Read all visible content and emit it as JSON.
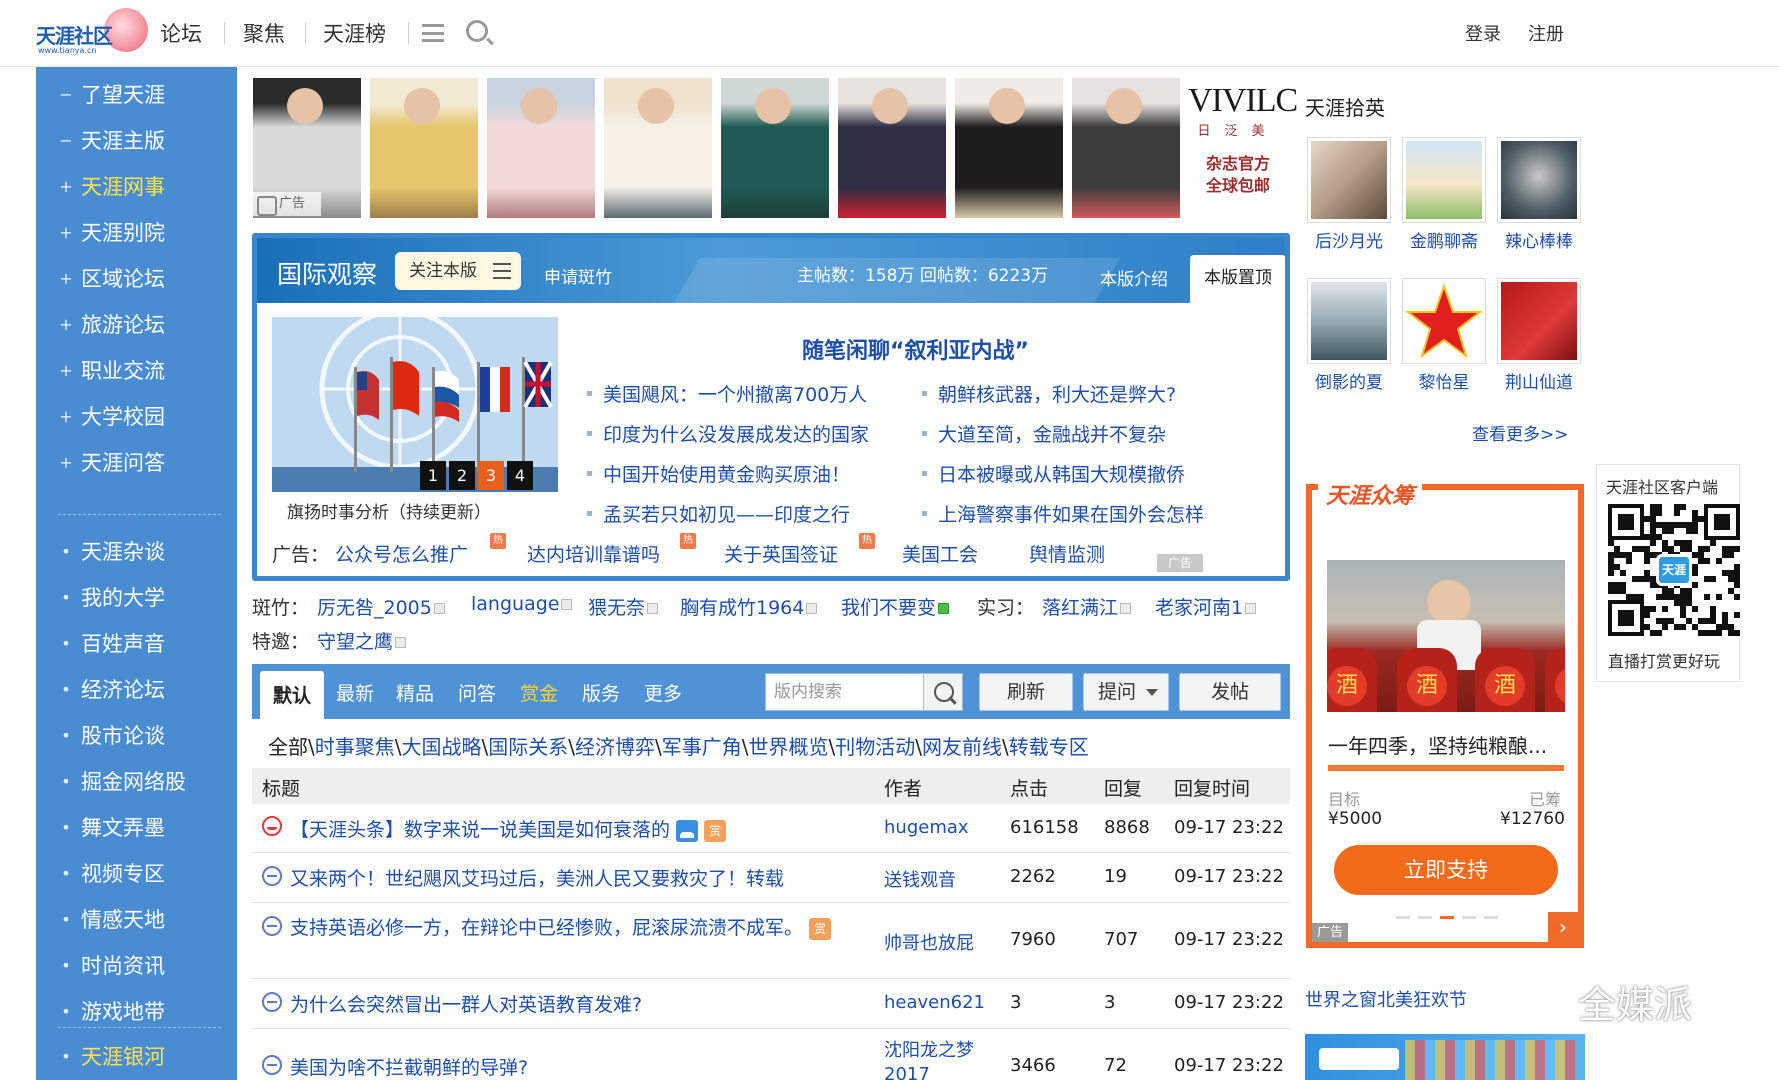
{
  "topbar": {
    "logo_text": "天涯社区",
    "logo_url": "www.tianya.cn",
    "nav": [
      "论坛",
      "聚焦",
      "天涯榜"
    ],
    "login": "登录",
    "register": "注册"
  },
  "sidebar": {
    "group1": [
      {
        "mark": "−",
        "label": "了望天涯",
        "highlight": false
      },
      {
        "mark": "−",
        "label": "天涯主版",
        "highlight": false
      },
      {
        "mark": "+",
        "label": "天涯网事",
        "highlight": true
      },
      {
        "mark": "+",
        "label": "天涯别院",
        "highlight": false
      },
      {
        "mark": "+",
        "label": "区域论坛",
        "highlight": false
      },
      {
        "mark": "+",
        "label": "旅游论坛",
        "highlight": false
      },
      {
        "mark": "+",
        "label": "职业交流",
        "highlight": false
      },
      {
        "mark": "+",
        "label": "大学校园",
        "highlight": false
      },
      {
        "mark": "+",
        "label": "天涯问答",
        "highlight": false
      }
    ],
    "group2": [
      {
        "mark": "•",
        "label": "天涯杂谈"
      },
      {
        "mark": "•",
        "label": "我的大学"
      },
      {
        "mark": "•",
        "label": "百姓声音"
      },
      {
        "mark": "•",
        "label": "经济论坛"
      },
      {
        "mark": "•",
        "label": "股市论谈"
      },
      {
        "mark": "•",
        "label": "掘金网络股"
      },
      {
        "mark": "•",
        "label": "舞文弄墨"
      },
      {
        "mark": "•",
        "label": "视频专区"
      },
      {
        "mark": "•",
        "label": "情感天地"
      },
      {
        "mark": "•",
        "label": "时尚资讯"
      },
      {
        "mark": "•",
        "label": "游戏地带"
      }
    ],
    "group3": {
      "mark": "•",
      "label": "天涯银河"
    }
  },
  "banner": {
    "ad_label": "广告",
    "brand": "VIVILC",
    "brand_sub": "日泛美",
    "brand_promo": [
      "杂志官方",
      "全球包邮"
    ]
  },
  "board": {
    "title": "国际观察",
    "follow": "关注本版",
    "apply": "申请斑竹",
    "stats": "主帖数：158万 回帖数：6223万",
    "intro": "本版介绍",
    "top": "本版置顶",
    "focus_caption": "旗扬时事分析（持续更新）",
    "slides": [
      "1",
      "2",
      "3",
      "4"
    ],
    "active_slide": 3,
    "headline": "随笔闲聊“叙利亚内战”",
    "links_left": [
      "美国飓风：一个州撤离700万人",
      "印度为什么没发展成发达的国家",
      "中国开始使用黄金购买原油！",
      "孟买若只如初见——印度之行"
    ],
    "links_right": [
      "朝鲜核武器，利大还是弊大?",
      "大道至简，金融战并不复杂",
      "日本被曝或从韩国大规模撤侨",
      "上海警察事件如果在国外会怎样"
    ],
    "ad_prefix": "广告：",
    "ads": [
      {
        "text": "公众号怎么推广",
        "hot": true
      },
      {
        "text": "达内培训靠谱吗",
        "hot": true
      },
      {
        "text": "关于英国签证",
        "hot": true
      },
      {
        "text": "美国工会",
        "hot": false
      },
      {
        "text": "舆情监测",
        "hot": false
      }
    ],
    "hot_label": "热",
    "ad_tag": "广告"
  },
  "moderators": {
    "label": "斑竹：",
    "list": [
      "厉无咎_2005",
      "language",
      "猥无奈",
      "胸有成竹1964",
      "我们不要变"
    ],
    "intern_label": "实习：",
    "interns": [
      "落红满江",
      "老家河南1"
    ],
    "guest_label": "特邀：",
    "guests": [
      "守望之鹰"
    ]
  },
  "tabs": {
    "items": [
      "默认",
      "最新",
      "精品",
      "问答",
      "赏金",
      "版务",
      "更多"
    ],
    "active": 0,
    "gold_index": 4,
    "search_placeholder": "版内搜索",
    "refresh": "刷新",
    "ask": "提问",
    "post": "发帖"
  },
  "categories": {
    "all": "全部",
    "sep": "\\",
    "list": [
      "时事聚焦",
      "大国战略",
      "国际关系",
      "经济博弈",
      "军事广角",
      "世界概览",
      "刊物活动",
      "网友前线",
      "转载专区"
    ]
  },
  "table": {
    "columns": [
      "标题",
      "作者",
      "点击",
      "回复",
      "回复时间"
    ],
    "rows": [
      {
        "title": "【天涯头条】数字来说一说美国是如何衰落的",
        "author": "hugemax",
        "clicks": "616158",
        "replies": "8868",
        "time": "09-17 23:22"
      },
      {
        "title": "又来两个！世纪飓风艾玛过后，美洲人民又要救灾了！转载",
        "author": "送钱观音",
        "clicks": "2262",
        "replies": "19",
        "time": "09-17 23:22"
      },
      {
        "title": "支持英语必修一方，在辩论中已经惨败，屁滚尿流溃不成军。",
        "author": "帅哥也放屁",
        "clicks": "7960",
        "replies": "707",
        "time": "09-17 23:22"
      },
      {
        "title": "为什么会突然冒出一群人对英语教育发难?",
        "author": "heaven621",
        "clicks": "3",
        "replies": "3",
        "time": "09-17 23:22"
      },
      {
        "title": "美国为啥不拦截朝鲜的导弹?",
        "author": "沈阳龙之梦2017",
        "clicks": "3466",
        "replies": "72",
        "time": "09-17 23:22"
      }
    ],
    "reward_label": "赏"
  },
  "right": {
    "pick_title": "天涯拾英",
    "picks": [
      "后沙月光",
      "金鹏聊斋",
      "辣心棒棒",
      "倒影的夏",
      "黎怡星",
      "荆山仙道"
    ],
    "more": "查看更多>>",
    "zc_logo": "天涯众筹",
    "jar_text": "酒",
    "zc_title": "一年四季，坚持纯粮酿...",
    "zc_goal_label": "目标",
    "zc_goal": "¥5000",
    "zc_done_label": "已筹",
    "zc_done": "¥12760",
    "zc_button": "立即支持",
    "zc_ad": "广告",
    "qr_title": "天涯社区客户端",
    "qr_center": "天涯",
    "qr_bottom": "直播打赏更好玩",
    "world_title": "世界之窗北美狂欢节",
    "watermark": "全媒派"
  },
  "colors": {
    "sidebar": "#4a8cd1",
    "link": "#1d4fa8",
    "accent": "#f06a2a",
    "highlight": "#ffe44d"
  }
}
